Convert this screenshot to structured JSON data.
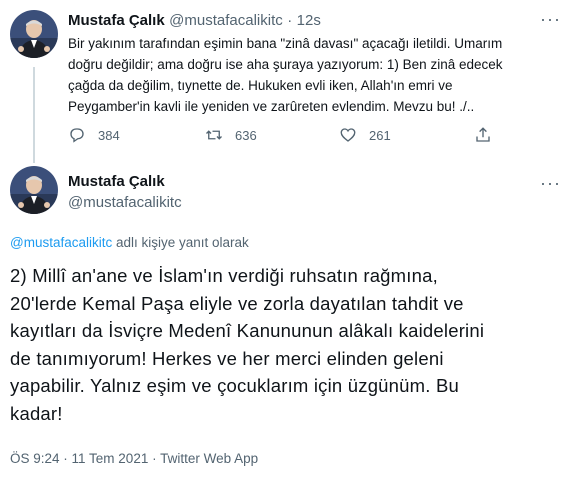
{
  "first_tweet": {
    "author_name": "Mustafa Çalık",
    "handle": "@mustafacalikitc",
    "separator": "·",
    "time": "12s",
    "lines": [
      "Bir yakınım tarafından eşimin bana \"zinâ davası\" açacağı iletildi. Umarım",
      "doğru değildir; ama doğru ise aha şuraya yazıyorum: 1) Ben zinâ edecek",
      "çağda da değilim, tıynette de. Hukuken evli iken, Allah'ın emri ve",
      "Peygamber'in kavli ile yeniden ve zarûreten evlendim. Mevzu bu! ./.."
    ],
    "reply_count": "384",
    "retweet_count": "636",
    "like_count": "261"
  },
  "second_tweet": {
    "author_name": "Mustafa Çalık",
    "handle": "@mustafacalikitc",
    "reply_to_handle": "@mustafacalikitc",
    "reply_to_suffix": "adlı kişiye yanıt olarak",
    "lines": [
      "2) Millî an'ane ve İslam'ın verdiği ruhsatın rağmına,",
      "20'lerde Kemal Paşa eliyle ve zorla dayatılan tahdit ve",
      "kayıtları da İsviçre Medenî Kanununun alâkalı kaidelerini",
      "de tanımıyorum! Herkes ve her merci elinden geleni",
      "yapabilir. Yalnız eşim ve çocuklarım için üzgünüm. Bu",
      "kadar!"
    ],
    "timestamp": "ÖS 9:24 · 11 Tem 2021 · Twitter Web App"
  },
  "icons": {
    "reply": "reply-icon",
    "retweet": "retweet-icon",
    "like": "heart-icon",
    "share": "share-icon",
    "more": "more-icon"
  },
  "colors": {
    "text": "#0f1419",
    "muted": "#536471",
    "link": "#1d9bf0",
    "divider": "#eff3f4"
  }
}
